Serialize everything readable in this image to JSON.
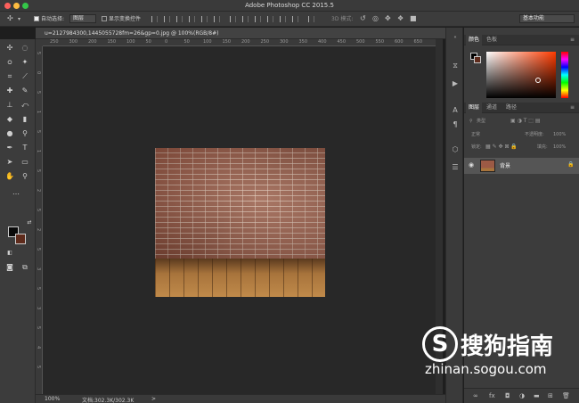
{
  "window": {
    "title": "Adobe Photoshop CC 2015.5"
  },
  "colors": {
    "close": "#fc605c",
    "minimize": "#fdbc40",
    "zoom": "#34c749",
    "foreground": "#0a0a0a",
    "background": "#5e2b1c"
  },
  "options": {
    "auto_select_label": "自动选择:",
    "auto_select_target": "图层",
    "show_transform_label": "显示变换控件",
    "mode_3d_label": "3D 模式:",
    "workspace": "基本功能"
  },
  "document": {
    "tab_title": "u=2127984300,1445055728fm=26&gp=0.jpg @ 100%(RGB/8#)"
  },
  "ruler": {
    "h_ticks": [
      "250",
      "300",
      "200",
      "150",
      "100",
      "50",
      "0",
      "50",
      "100",
      "150",
      "200",
      "250",
      "300",
      "350",
      "400",
      "450",
      "500",
      "550",
      "600",
      "650"
    ],
    "v_ticks": [
      "5",
      "0",
      "5",
      "1",
      "5",
      "1",
      "5",
      "2",
      "5",
      "2",
      "5",
      "3",
      "5",
      "3",
      "5",
      "4",
      "5"
    ]
  },
  "status": {
    "zoom": "100%",
    "doc_size": "文档:302.3K/302.3K",
    "arrow": ">"
  },
  "color_panel": {
    "tabs": [
      "颜色",
      "色板"
    ]
  },
  "layers_panel": {
    "tabs": [
      "图层",
      "通道",
      "路径"
    ],
    "filter_label": "类型",
    "blend_mode": "正常",
    "opacity_label": "不透明度:",
    "opacity_value": "100%",
    "lock_label": "锁定:",
    "fill_label": "填充:",
    "fill_value": "100%",
    "layers": [
      {
        "name": "背景"
      }
    ]
  },
  "watermark": {
    "logo_letter": "S",
    "name": "搜狗指南",
    "url": "zhinan.sogou.com"
  }
}
